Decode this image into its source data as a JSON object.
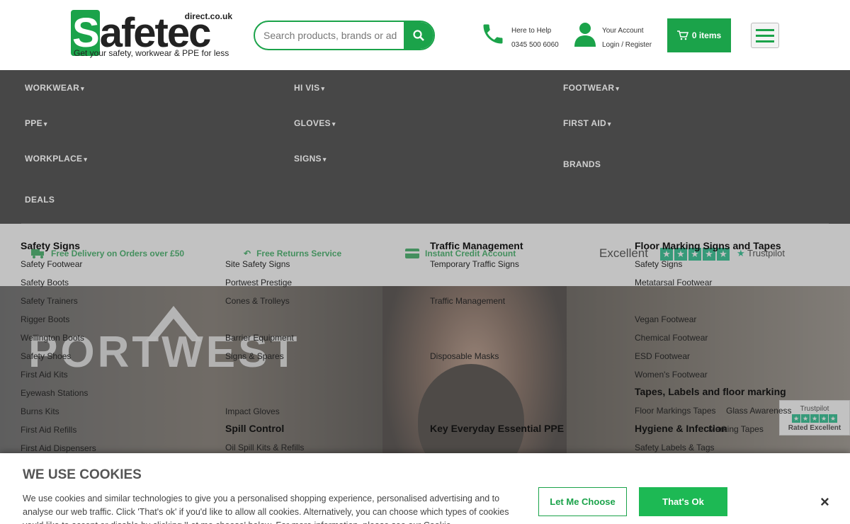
{
  "header": {
    "logo_main_s": "S",
    "logo_main_rest": "afetec",
    "logo_domain": "direct.co.uk",
    "logo_tagline": "Get your safety, workwear & PPE for less",
    "search_placeholder": "Search products, brands or ad",
    "help_line1": "Here to Help",
    "help_line2": "0345 500 6060",
    "account_line1": "Your Account",
    "account_line2": "Login / Register",
    "cart_label": "0 items",
    "brand_color": "#1ba34a"
  },
  "nav": {
    "items": [
      {
        "label": "WORKWEAR",
        "dropdown": true
      },
      {
        "label": "HI VIS",
        "dropdown": true
      },
      {
        "label": "FOOTWEAR",
        "dropdown": true
      },
      {
        "label": "PPE",
        "dropdown": true
      },
      {
        "label": "GLOVES",
        "dropdown": true
      },
      {
        "label": "FIRST AID",
        "dropdown": true
      },
      {
        "label": "WORKPLACE",
        "dropdown": true
      },
      {
        "label": "SIGNS",
        "dropdown": true
      },
      {
        "label": "BRANDS",
        "dropdown": false
      },
      {
        "label": "DEALS",
        "dropdown": false
      }
    ]
  },
  "dropdown": {
    "col1": {
      "headings": [
        "Safety Signs"
      ],
      "links": [
        "Safety Footwear",
        "Safety Boots",
        "Safety Trainers",
        "Rigger Boots",
        "Wellington Boots",
        "Safety Shoes",
        "First Aid Kits",
        "Eyewash Stations",
        "Burns Kits",
        "First Aid Refills",
        "First Aid Dispensers"
      ]
    },
    "col2": {
      "headings": [
        "Spill Control"
      ],
      "links": [
        "Site Safety Signs",
        "Portwest Prestige",
        "Cones & Trolleys",
        "Barrier Equipment",
        "Signs & Spares",
        "Impact Gloves",
        "Oil Spill Kits & Refills"
      ]
    },
    "col3": {
      "headings": [
        "Traffic Management",
        "Key Everyday Essential PPE"
      ],
      "links": [
        "Temporary Traffic Signs",
        "Traffic Management",
        "Disposable Masks"
      ]
    },
    "col4": {
      "headings": [
        "Floor Marking Signs and Tapes",
        "Tapes, Labels and floor marking",
        "Hygiene & Infection"
      ],
      "links": [
        "Safety Signs",
        "Metatarsal Footwear",
        "Vegan Footwear",
        "Chemical Footwear",
        "ESD Footwear",
        "Women's Footwear",
        "Floor Markings Tapes",
        "Glass Awareness",
        "Marking Tapes",
        "Safety Labels & Tags"
      ]
    }
  },
  "usp": {
    "delivery": "Free Delivery on Orders over £50",
    "returns": "Free Returns Service",
    "credit": "Instant Credit Account",
    "tp_excellent": "Excellent",
    "tp_brand": "Trustpilot",
    "tp_rated": "Rated Excellent"
  },
  "hero": {
    "brand": "PORTWEST"
  },
  "cookie": {
    "title": "WE USE COOKIES",
    "text": "We use cookies and similar technologies to give you a personalised shopping experience, personalised advertising and to analyse our web traffic. Click 'That's ok' if you'd like to allow all cookies. Alternatively, you can choose which types of cookies you'd like to accept or disable by clicking 'Let me choose' below. For more information, please see our Cookie",
    "choose_label": "Let Me Choose",
    "ok_label": "That's Ok",
    "close_label": "×"
  }
}
